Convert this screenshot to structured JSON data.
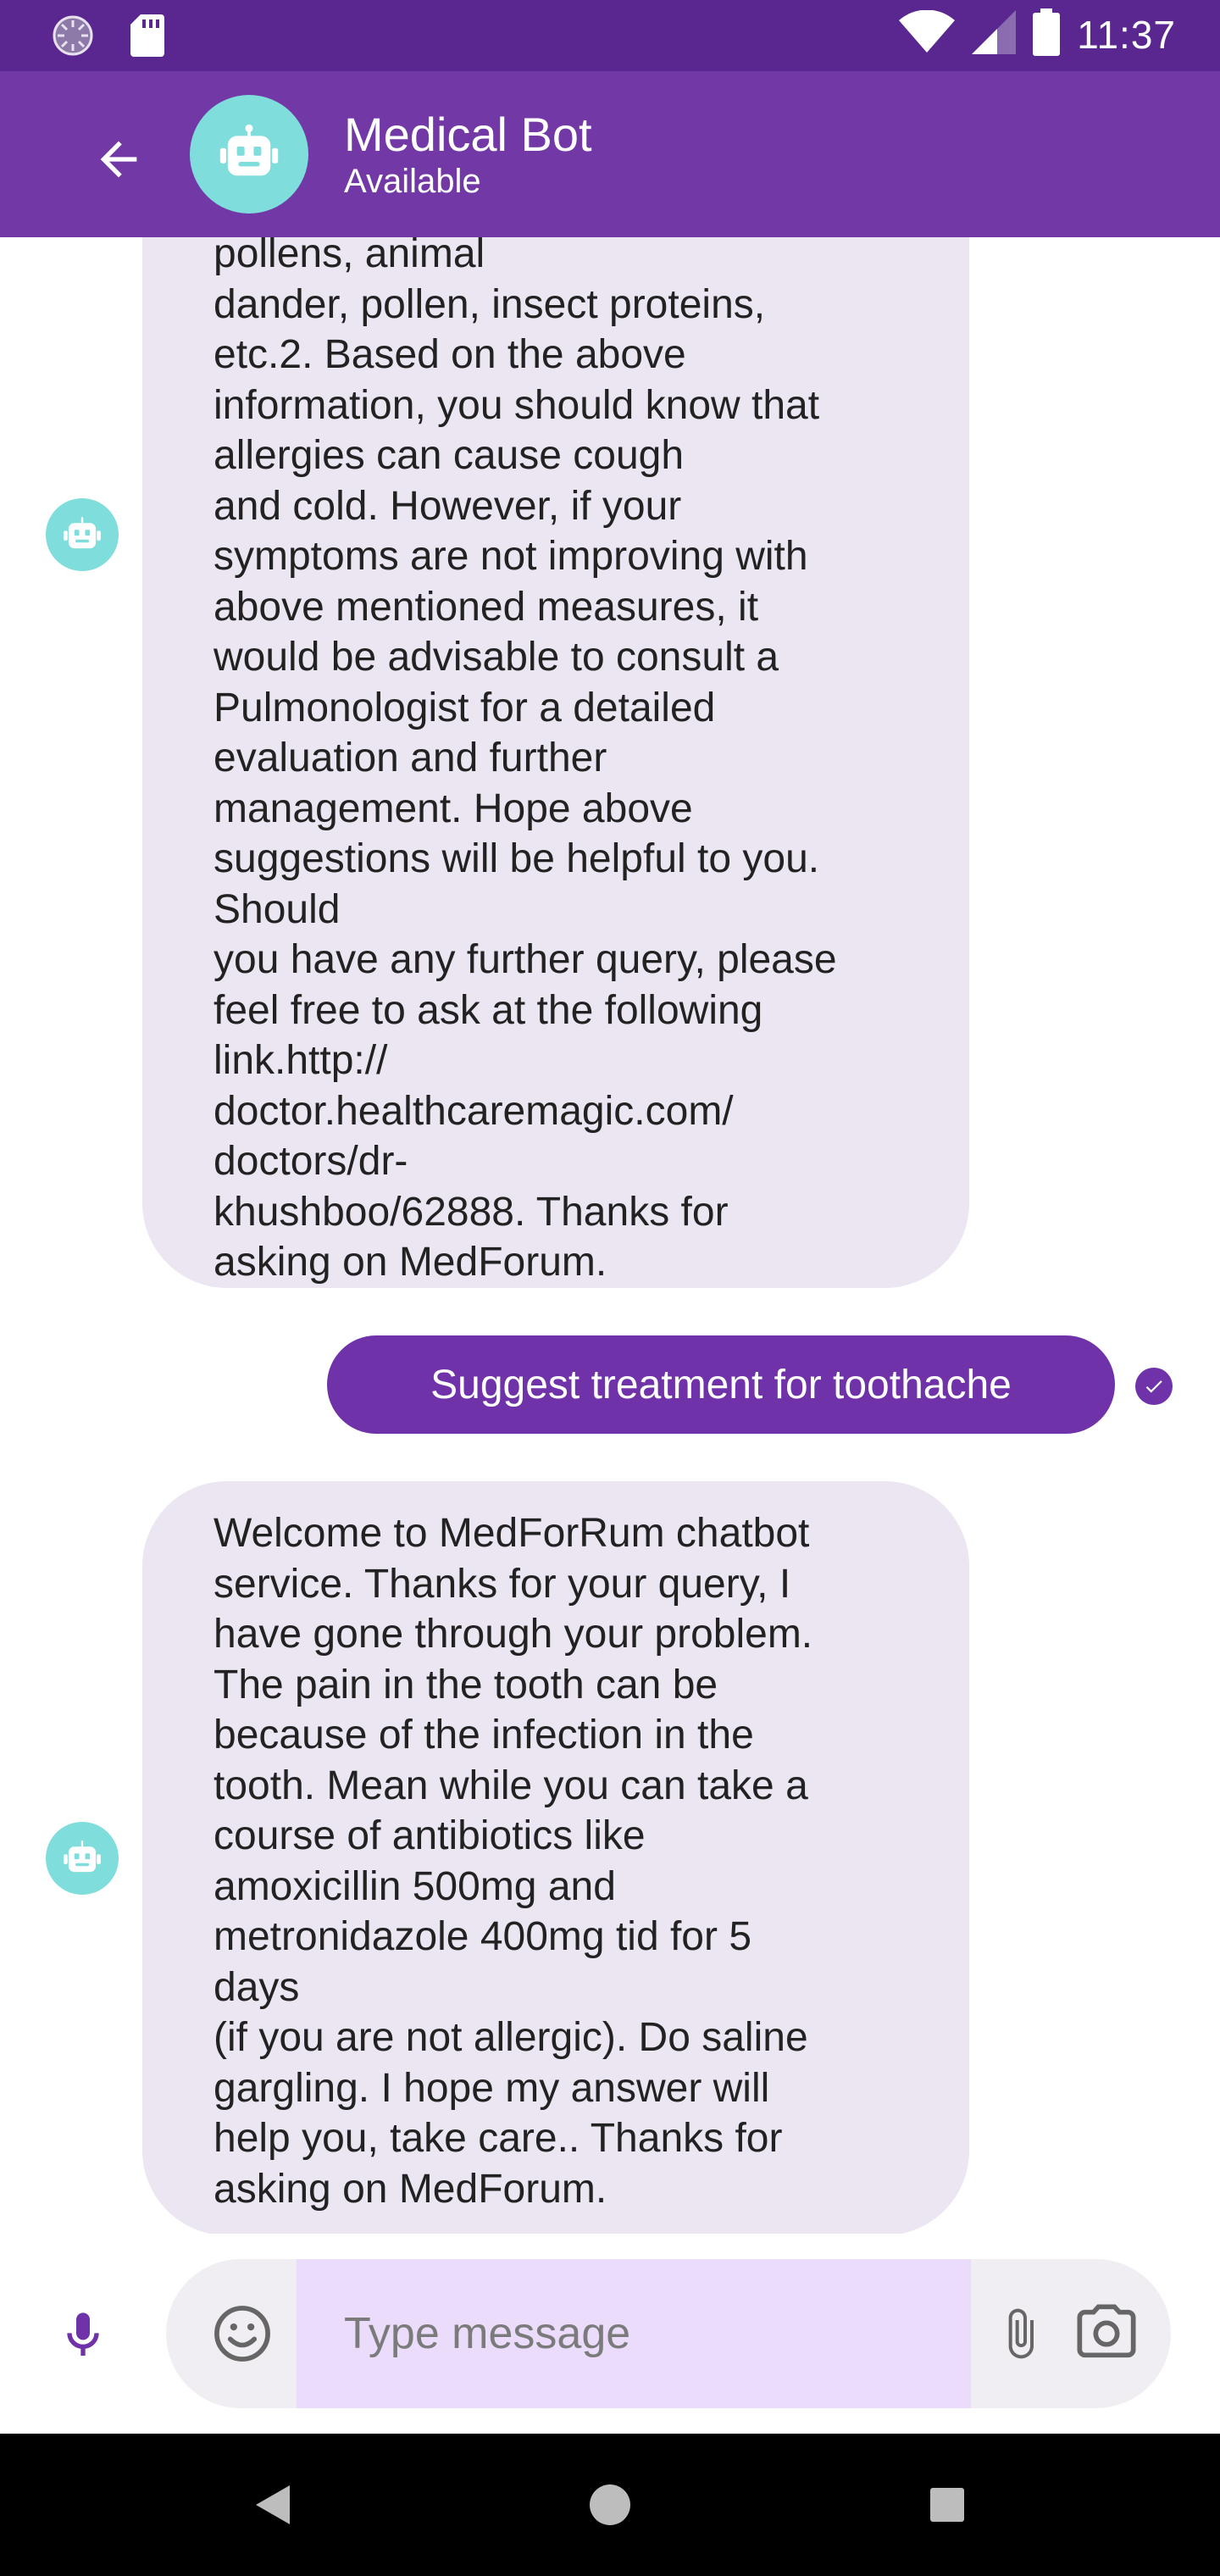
{
  "status_bar": {
    "time": "11:37",
    "icons": [
      "spinner-icon",
      "sd-card-icon",
      "wifi-icon",
      "cell-signal-icon",
      "battery-icon"
    ]
  },
  "header": {
    "back_icon": "arrow-left-icon",
    "title": "Medical Bot",
    "subtitle": "Available",
    "avatar_icon": "robot-icon"
  },
  "messages": [
    {
      "from": "bot",
      "text": "pollens, animal\ndander, pollen, insect proteins,\netc.2. Based on the above\ninformation, you should know that\nallergies can cause cough\nand cold. However, if your\nsymptoms are not improving with\nabove mentioned measures, it\nwould be advisable to consult a\nPulmonologist for a detailed\nevaluation and further\nmanagement. Hope above\nsuggestions will be helpful to you.\nShould\nyou have any further query, please\nfeel free to ask at the following\nlink.http://\ndoctor.healthcaremagic.com/\ndoctors/dr-\nkhushboo/62888. Thanks for\nasking on MedForum."
    },
    {
      "from": "user",
      "text": "Suggest treatment for toothache",
      "status": "sent"
    },
    {
      "from": "bot",
      "text": "Welcome to MedForRum chatbot\nservice. Thanks for your query,  I\nhave gone through your problem.\nThe pain in the tooth can be\nbecause of the infection in the\ntooth.  Mean while you can take a\ncourse of antibiotics like\namoxicillin 500mg and\nmetronidazole 400mg tid for 5\ndays\n(if you are not allergic).  Do saline\ngargling. I hope my answer will\nhelp you, take care.. Thanks for\nasking on MedForum."
    }
  ],
  "composer": {
    "placeholder": "Type message",
    "value": ""
  },
  "nav": [
    "back-triangle-icon",
    "home-circle-icon",
    "recents-square-icon"
  ],
  "colors": {
    "status_bar": "#5a2790",
    "app_bar": "#7138a6",
    "accent": "#6f32a8",
    "bot_avatar": "#7fdedc",
    "bot_bubble": "#ebe6f2",
    "input_field": "#ecdcfc"
  }
}
